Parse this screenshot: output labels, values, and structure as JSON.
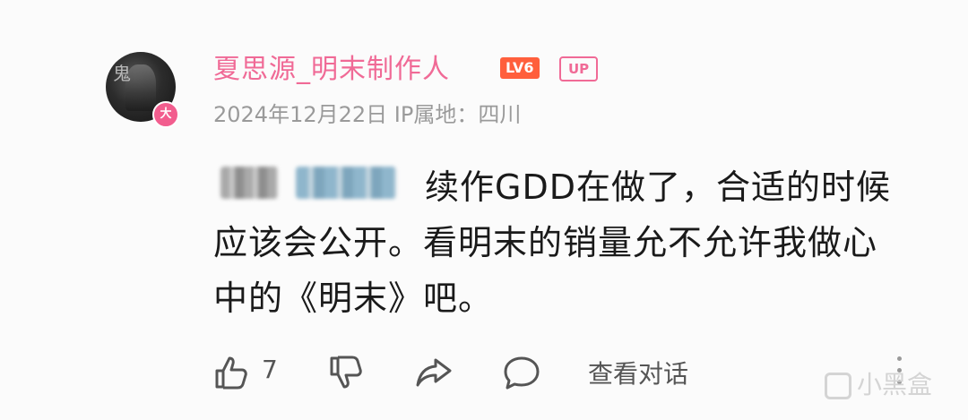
{
  "comment": {
    "author": {
      "name": "夏思源_明末制作人",
      "level_badge": "LV6",
      "up_badge": "UP",
      "avatar_badge": "大",
      "avatar_glyph": "鬼"
    },
    "meta": "2024年12月22日 IP属地：四川",
    "content": {
      "line1": "续作GDD在做了，合适的时候",
      "line2": "应该会公开。看明末的销量允不允许我做心",
      "line3": "中的《明末》吧。"
    },
    "actions": {
      "like_count": "7",
      "view_dialog_label": "查看对话"
    }
  },
  "watermark": {
    "text": "小黑盒"
  },
  "colors": {
    "username": "#f06a96",
    "level_badge": "#ff5f3c",
    "meta_text": "#9a9a9a",
    "body_text": "#1a1a1a",
    "icon": "#555555"
  }
}
